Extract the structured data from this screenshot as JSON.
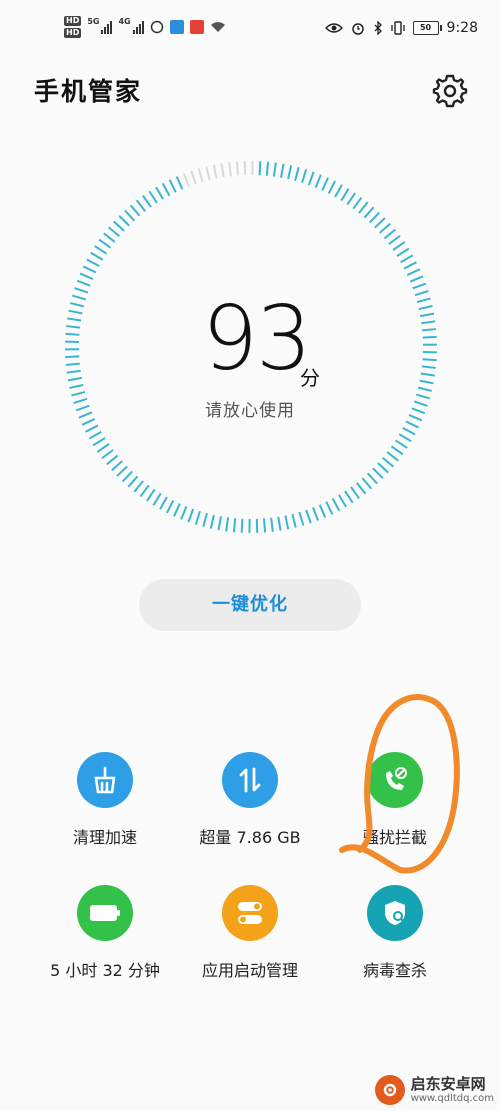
{
  "status_bar": {
    "hd1": "HD",
    "hd2": "HD",
    "net1": "5G",
    "net2": "4G",
    "battery": "50",
    "time": "9:28"
  },
  "header": {
    "title": "手机管家",
    "settings_icon": "gear-icon"
  },
  "score": {
    "value": "93",
    "unit": "分",
    "subtitle": "请放心使用",
    "ring_progress": 0.93
  },
  "optimize_button": {
    "label": "一键优化"
  },
  "tiles": [
    {
      "id": "cleanup",
      "icon": "broom-icon",
      "label": "清理加速",
      "color": "#2e9fe6"
    },
    {
      "id": "data",
      "icon": "data-transfer-icon",
      "label": "超量 7.86 GB",
      "color": "#2e9fe6"
    },
    {
      "id": "block",
      "icon": "phone-block-icon",
      "label": "骚扰拦截",
      "color": "#34c149"
    },
    {
      "id": "battery",
      "icon": "battery-icon",
      "label": "5 小时 32 分钟",
      "color": "#34c149"
    },
    {
      "id": "startup",
      "icon": "toggle-icon",
      "label": "应用启动管理",
      "color": "#f5a21b"
    },
    {
      "id": "virus",
      "icon": "shield-scan-icon",
      "label": "病毒查杀",
      "color": "#16a3b3"
    }
  ],
  "colors": {
    "accent": "#1a8fd8",
    "ring": "#38b6cf",
    "ring_dim": "#d9d9d9",
    "annotation": "#f08a2a"
  },
  "watermark": {
    "name": "启东安卓网",
    "url": "www.qdltdq.com"
  }
}
